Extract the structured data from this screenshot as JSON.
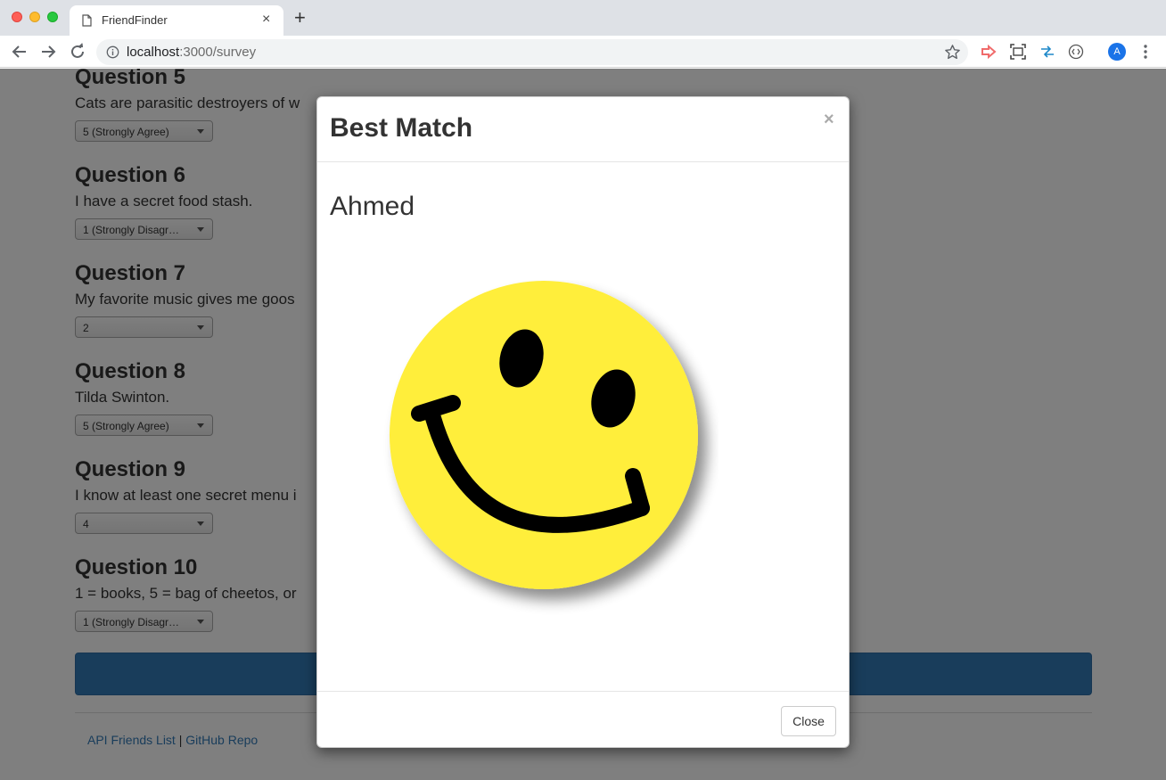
{
  "browser": {
    "tab_title": "FriendFinder",
    "tab_close": "×",
    "new_tab": "+",
    "url_host": "localhost",
    "url_path": ":3000/survey",
    "profile_initial": "A"
  },
  "survey": {
    "questions": [
      {
        "title": "Question 5",
        "text": "Cats are parasitic destroyers of w",
        "selected": "5 (Strongly Agree)"
      },
      {
        "title": "Question 6",
        "text": "I have a secret food stash.",
        "selected": "1 (Strongly Disagr…"
      },
      {
        "title": "Question 7",
        "text": "My favorite music gives me goos",
        "selected": "2"
      },
      {
        "title": "Question 8",
        "text": "Tilda Swinton.",
        "selected": "5 (Strongly Agree)"
      },
      {
        "title": "Question 9",
        "text": "I know at least one secret menu i",
        "selected": "4"
      },
      {
        "title": "Question 10",
        "text": "1 = books, 5 = bag of cheetos, or",
        "selected": "1 (Strongly Disagr…"
      }
    ],
    "submit_color": "#337ab7"
  },
  "footer": {
    "link_friends": "API Friends List",
    "separator": "|",
    "link_repo": "GitHub Repo"
  },
  "modal": {
    "title": "Best Match",
    "close_x": "×",
    "match_name": "Ahmed",
    "close_button": "Close"
  },
  "colors": {
    "smiley_face": "#ffee3a",
    "link": "#337ab7",
    "profile": "#1a73e8"
  }
}
